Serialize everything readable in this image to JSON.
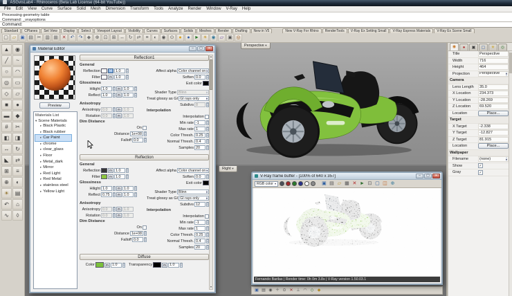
{
  "window": {
    "title": "ASGvisLab4 - Rhinoceros (Beta Lab License (64-bit YouTube))"
  },
  "menu": [
    "File",
    "Edit",
    "View",
    "Curve",
    "Surface",
    "Solid",
    "Mesh",
    "Dimension",
    "Transform",
    "Tools",
    "Analyze",
    "Render",
    "Window",
    "V-Ray",
    "Help"
  ],
  "command_area": {
    "history_line1": "Processing geometry table",
    "history_line2": "Command: _vrayoptions",
    "prompt": "Command:"
  },
  "toolbar_tabs": [
    "Standard",
    "CPlanes",
    "Set View",
    "Display",
    "Select",
    "Viewport Layout",
    "Visibility",
    "Curves",
    "Surfaces",
    "Solids",
    "Meshes",
    "Render",
    "Drafting",
    "New in V5"
  ],
  "vray_tabs": [
    "New V-Ray For Rhino",
    "RenderTools",
    "V-Ray Ex Setting Small",
    "V-Ray Express Materials",
    "V-Ray Ex Scene Small"
  ],
  "main_toolbar_icons": [
    {
      "name": "new-file-icon",
      "glyph": "▢",
      "color": "#555"
    },
    {
      "name": "open-file-icon",
      "glyph": "▱",
      "color": "#b8912f"
    },
    {
      "name": "save-file-icon",
      "glyph": "▣",
      "color": "#3a62a8"
    },
    {
      "name": "print-icon",
      "glyph": "▤",
      "color": "#555"
    },
    {
      "name": "cut-icon",
      "glyph": "✂",
      "color": "#555"
    },
    {
      "name": "copy-icon",
      "glyph": "▥",
      "color": "#555"
    },
    {
      "name": "paste-icon",
      "glyph": "▦",
      "color": "#777"
    },
    {
      "name": "delete-icon",
      "glyph": "✕",
      "color": "#a03030"
    },
    {
      "name": "undo-icon",
      "glyph": "↶",
      "color": "#33518a"
    },
    {
      "name": "redo-icon",
      "glyph": "↷",
      "color": "#33518a"
    },
    {
      "name": "pan-icon",
      "glyph": "◆",
      "color": "#777"
    },
    {
      "name": "zoom-icon",
      "glyph": "⊕",
      "color": "#555"
    },
    {
      "name": "zoom-window-icon",
      "glyph": "⊡",
      "color": "#555"
    },
    {
      "name": "zoom-extents-icon",
      "glyph": "⊞",
      "color": "#555"
    },
    {
      "name": "move-icon",
      "glyph": "↔",
      "color": "#555"
    },
    {
      "name": "rotate-icon",
      "glyph": "↻",
      "color": "#555"
    },
    {
      "name": "mirror-icon",
      "glyph": "⇄",
      "color": "#555"
    },
    {
      "name": "layers-icon",
      "glyph": "≡",
      "color": "#555"
    },
    {
      "name": "hide-icon",
      "glyph": "◐",
      "color": "#555"
    },
    {
      "name": "lock-icon",
      "glyph": "◉",
      "color": "#555"
    },
    {
      "name": "grid-snap-icon",
      "glyph": "⊙",
      "color": "#555"
    },
    {
      "name": "vray-options-icon",
      "glyph": "●",
      "color": "#d8a020"
    },
    {
      "name": "vray-material-editor-icon",
      "glyph": "●",
      "color": "#3a62a8"
    },
    {
      "name": "vray-render-icon",
      "glyph": "►",
      "color": "#2a7a2a"
    },
    {
      "name": "vray-light-icon",
      "glyph": "☀",
      "color": "#c09020"
    },
    {
      "name": "vray-sphere-icon",
      "glyph": "◉",
      "color": "#3a7a9a"
    },
    {
      "name": "vray-plane-icon",
      "glyph": "▱",
      "color": "#6a4aa0"
    },
    {
      "name": "vray-camera-icon",
      "glyph": "▣",
      "color": "#555"
    },
    {
      "name": "vray-help-icon",
      "glyph": "◎",
      "color": "#a05a20"
    }
  ],
  "sidebar_icons": [
    {
      "name": "select-tool-icon",
      "glyph": "▲",
      "color": "#3f3f3f"
    },
    {
      "name": "point-tool-icon",
      "glyph": "◉",
      "color": "#3f3f3f"
    },
    {
      "name": "line-tool-icon",
      "glyph": "╱",
      "color": "#3f3f3f"
    },
    {
      "name": "curve-tool-icon",
      "glyph": "~",
      "color": "#3f3f3f"
    },
    {
      "name": "circle-tool-icon",
      "glyph": "○",
      "color": "#3f3f3f"
    },
    {
      "name": "arc-tool-icon",
      "glyph": "◠",
      "color": "#3f3f3f"
    },
    {
      "name": "ellipse-tool-icon",
      "glyph": "◎",
      "color": "#3f3f3f"
    },
    {
      "name": "rectangle-tool-icon",
      "glyph": "▭",
      "color": "#3f3f3f"
    },
    {
      "name": "polygon-tool-icon",
      "glyph": "◇",
      "color": "#3f3f3f"
    },
    {
      "name": "plane-tool-icon",
      "glyph": "▱",
      "color": "#3f3f3f"
    },
    {
      "name": "box-tool-icon",
      "glyph": "■",
      "color": "#3f3f3f"
    },
    {
      "name": "sphere-tool-icon",
      "glyph": "●",
      "color": "#3f3f3f"
    },
    {
      "name": "cylinder-tool-icon",
      "glyph": "▬",
      "color": "#3f3f3f"
    },
    {
      "name": "pipe-tool-icon",
      "glyph": "◆",
      "color": "#3f3f3f"
    },
    {
      "name": "mesh-tool-icon",
      "glyph": "#",
      "color": "#3f3f3f"
    },
    {
      "name": "trim-tool-icon",
      "glyph": "✂",
      "color": "#3f3f3f"
    },
    {
      "name": "split-tool-icon",
      "glyph": "◧",
      "color": "#3f3f3f"
    },
    {
      "name": "join-tool-icon",
      "glyph": "◨",
      "color": "#3f3f3f"
    },
    {
      "name": "move-tool-icon",
      "glyph": "↔",
      "color": "#3f3f3f"
    },
    {
      "name": "rotate-tool-icon",
      "glyph": "↻",
      "color": "#3f3f3f"
    },
    {
      "name": "scale-tool-icon",
      "glyph": "◣",
      "color": "#3f3f3f"
    },
    {
      "name": "mirror-tool-icon",
      "glyph": "⇄",
      "color": "#3f3f3f"
    },
    {
      "name": "array-tool-icon",
      "glyph": "⊞",
      "color": "#3f3f3f"
    },
    {
      "name": "layers-panel-icon",
      "glyph": "≡",
      "color": "#3f3f3f"
    },
    {
      "name": "zoom-tool-icon",
      "glyph": "⊕",
      "color": "#3f3f3f"
    },
    {
      "name": "shade-tool-icon",
      "glyph": "◐",
      "color": "#3f3f3f"
    },
    {
      "name": "light-tool-icon",
      "glyph": "☀",
      "color": "#8a6a20"
    },
    {
      "name": "properties-tool-icon",
      "glyph": "▤",
      "color": "#3f3f3f"
    },
    {
      "name": "undo-view-icon",
      "glyph": "↶",
      "color": "#3f3f3f"
    },
    {
      "name": "home-view-icon",
      "glyph": "⌂",
      "color": "#3f3f3f"
    },
    {
      "name": "curve-edit-icon",
      "glyph": "∿",
      "color": "#3f3f3f"
    },
    {
      "name": "analyze-tool-icon",
      "glyph": "◊",
      "color": "#3f3f3f"
    }
  ],
  "viewport": {
    "perspective_label": "Perspective",
    "right_label": "Right",
    "tab_arrow": "▾"
  },
  "material_editor": {
    "title": "Material Editor",
    "preview_button": "Preview",
    "materials_header": "Materials List",
    "tree_root": "Scene Materials",
    "materials": [
      {
        "label": "Black Plastic"
      },
      {
        "label": "Black rubber"
      },
      {
        "label": "Car Paint",
        "selected": true
      },
      {
        "label": "chrome"
      },
      {
        "label": "clear_glass"
      },
      {
        "label": "Floor"
      },
      {
        "label": "Metal_dark"
      },
      {
        "label": "Mirror"
      },
      {
        "label": "Red Light"
      },
      {
        "label": "Red Metal"
      },
      {
        "label": "stainless steel"
      },
      {
        "label": "Yellow Light"
      }
    ],
    "labels": {
      "general": "General",
      "reflection": "Reflection",
      "filter": "Filter",
      "affect_alpha": "Affect alpha",
      "soften": "Soften",
      "exit_color": "Exit color",
      "glossiness": "Glossiness",
      "hilight": "Hilight",
      "reflect": "Reflect",
      "shader_type": "Shader Type",
      "treat_glossy": "Treat glossy as GI",
      "subdivs": "Subdivs",
      "anisotropy": "Anisotropy",
      "rotation": "Rotation",
      "dim_distance": "Dim Distance",
      "on": "On",
      "distance": "Distance",
      "falloff": "Falloff",
      "interpolation": "Interpolation",
      "min_rate": "Min rate",
      "max_rate": "Max rate",
      "color_thresh": "Color Thresh.",
      "normal_thresh": "Normal Thresh.",
      "samples": "Samples",
      "diffuse_color": "Color",
      "transparency": "Transparency",
      "map_small": "m"
    },
    "refl1": {
      "title": "Reflection1",
      "reflection_map": "M",
      "reflection_mult": "1.0",
      "filter_mult": "1.0",
      "affect_alpha": "Color channel on",
      "soften": "0.0",
      "hilight": "1.0",
      "hilight_mult": "1.0",
      "reflect": "1.0",
      "reflect_mult": "1.0",
      "shader_type": "Blinn",
      "treat_glossy": "GI rays only",
      "subdivs": "8",
      "aniso": "0.0",
      "aniso_mult": "1.0",
      "rotation": "0.0",
      "rotation_mult": "1.0",
      "min_rate": "-1",
      "max_rate": "1",
      "color_thresh": "0.25",
      "normal_thresh": "0.4",
      "samples": "20",
      "distance": "1e+08",
      "falloff": "0.0",
      "colors": {
        "reflection": "#f8f8f8",
        "filter": "#f8f8f8",
        "exit": "#000000"
      }
    },
    "refl2": {
      "title": "Reflection",
      "reflection_map": "m",
      "reflection_mult": "1.0",
      "filter_mult": "1.0",
      "affect_alpha": "Color channel on",
      "soften": "0.0",
      "hilight": "1.0",
      "hilight_mult": "1.0",
      "reflect": "0.75",
      "reflect_mult": "1.0",
      "shader_type": "Blinn",
      "treat_glossy": "GI rays only",
      "subdivs": "12",
      "aniso": "0.0",
      "aniso_mult": "1.0",
      "rotation": "0.0",
      "rotation_mult": "1.0",
      "min_rate": "-1",
      "max_rate": "1",
      "color_thresh": "0.25",
      "normal_thresh": "0.4",
      "samples": "20",
      "distance": "1e+08",
      "falloff": "0.0",
      "colors": {
        "reflection": "#383838",
        "filter": "#8dc63f",
        "exit": "#000000"
      }
    },
    "diffuse": {
      "title": "Diffuse",
      "color_mult": "1.0",
      "transparency_mult": "1.0",
      "colors": {
        "color": "#7cc13b",
        "transparency": "#000000"
      }
    }
  },
  "vfb": {
    "title": "V-Ray frame buffer - [100% of 640 x 357]",
    "channel_dropdown": "RGB color",
    "channels": [
      {
        "name": "rgb-channel-icon",
        "color": "#4a5058"
      },
      {
        "name": "red-channel-icon",
        "color": "#a02828"
      },
      {
        "name": "green-channel-icon",
        "color": "#2a7a2a"
      },
      {
        "name": "blue-channel-icon",
        "color": "#28328a"
      },
      {
        "name": "alpha-channel-icon",
        "color": "#ffffff"
      },
      {
        "name": "mono-channel-icon",
        "color": "#8a8a8a"
      }
    ],
    "toolbar_icons": [
      {
        "name": "save-image-icon",
        "glyph": "▣",
        "color": "#2f5fa0"
      },
      {
        "name": "copy-image-icon",
        "glyph": "▤",
        "color": "#555"
      },
      {
        "name": "open-image-icon",
        "glyph": "▱",
        "color": "#b8912f"
      },
      {
        "name": "clear-image-icon",
        "glyph": "▦",
        "color": "#555"
      },
      {
        "name": "stop-render-icon",
        "glyph": "✕",
        "color": "#b02020"
      },
      {
        "name": "track-mouse-icon",
        "glyph": "►",
        "color": "#2f6f2f"
      },
      {
        "name": "region-render-icon",
        "glyph": "⊡",
        "color": "#555"
      },
      {
        "name": "monitor-icon",
        "glyph": "▢",
        "color": "#2f5fa0"
      },
      {
        "name": "compare-history-icon",
        "glyph": "◫",
        "color": "#c06020"
      },
      {
        "name": "color-correction-icon",
        "glyph": "⊕",
        "color": "#3a7a9a"
      }
    ],
    "status": "Fernando Barilas | Render time: 0h 0m 3.8s | V-Ray version 1.50.03.1"
  },
  "below_vfb_icons": [
    {
      "name": "osnap-end-icon",
      "glyph": "▣",
      "color": "#3a62a8"
    },
    {
      "name": "osnap-near-icon",
      "glyph": "▤",
      "color": "#555"
    },
    {
      "name": "osnap-point-icon",
      "glyph": "◉",
      "color": "#555"
    },
    {
      "name": "osnap-mid-icon",
      "glyph": "＋",
      "color": "#555"
    },
    {
      "name": "osnap-cen-icon",
      "glyph": "⊙",
      "color": "#555"
    },
    {
      "name": "osnap-int-icon",
      "glyph": "✕",
      "color": "#a03030"
    },
    {
      "name": "osnap-perp-icon",
      "glyph": "⊥",
      "color": "#555"
    },
    {
      "name": "osnap-tan-icon",
      "glyph": "◠",
      "color": "#555"
    },
    {
      "name": "osnap-quad-icon",
      "glyph": "◇",
      "color": "#2f6f2f"
    },
    {
      "name": "osnap-knot-icon",
      "glyph": "◆",
      "color": "#b8912f"
    }
  ],
  "properties_panel": {
    "tabs": [
      {
        "name": "properties-tab-object",
        "glyph": "◉",
        "color": "#c87828",
        "selected": true
      },
      {
        "name": "properties-tab-material",
        "glyph": "●",
        "color": "#b03030"
      },
      {
        "name": "properties-tab-viewport",
        "glyph": "▣",
        "color": "#404040"
      },
      {
        "name": "properties-tab-display",
        "glyph": "▢",
        "color": "#3a62a8"
      },
      {
        "name": "properties-tab-light",
        "glyph": "☀",
        "color": "#c8a020"
      },
      {
        "name": "properties-tab-vray",
        "glyph": "◎",
        "color": "#3a7a3a"
      }
    ],
    "fields": [
      {
        "label": "Title",
        "value": "Perspective",
        "type": "text"
      },
      {
        "label": "Width",
        "value": "716",
        "type": "text"
      },
      {
        "label": "Height",
        "value": "464",
        "type": "text"
      },
      {
        "label": "Projection",
        "value": "Perspective",
        "type": "dropdown"
      },
      {
        "label": "Camera",
        "value": "",
        "type": "header"
      },
      {
        "label": "Lens Length",
        "value": "35.0",
        "type": "text"
      },
      {
        "label": "X Location",
        "value": "234.373",
        "type": "text"
      },
      {
        "label": "Y Location",
        "value": "-28.269",
        "type": "text"
      },
      {
        "label": "Z Location",
        "value": "69.520",
        "type": "text"
      },
      {
        "label": "Location",
        "value": "Place...",
        "type": "button"
      },
      {
        "label": "Target",
        "value": "",
        "type": "header"
      },
      {
        "label": "X Target",
        "value": "-2.338",
        "type": "text"
      },
      {
        "label": "Y Target",
        "value": "-12.827",
        "type": "text"
      },
      {
        "label": "Z Target",
        "value": "81.915",
        "type": "text"
      },
      {
        "label": "Location",
        "value": "Place...",
        "type": "button"
      },
      {
        "label": "Wallpaper",
        "value": "",
        "type": "header"
      },
      {
        "label": "Filename",
        "value": "(none)",
        "type": "dropdown"
      },
      {
        "label": "Show",
        "value": "✓",
        "type": "check"
      },
      {
        "label": "Gray",
        "value": "✓",
        "type": "check"
      }
    ]
  },
  "colors": {
    "accent_green": "#7cc13b",
    "selection_blue": "#cbe0f7",
    "viewport_gray": "#9c9c9c"
  }
}
